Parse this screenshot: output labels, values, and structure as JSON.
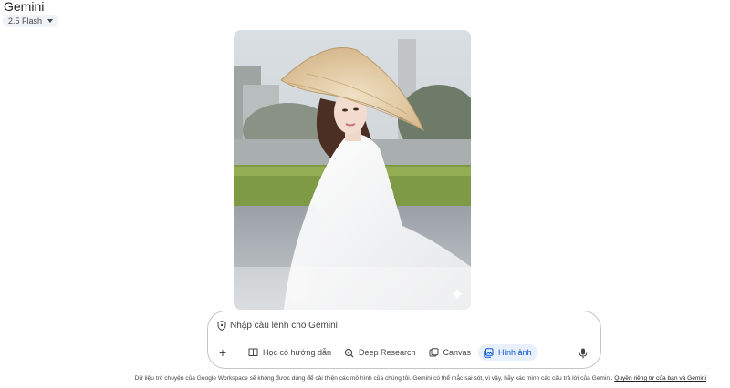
{
  "header": {
    "app_title": "Gemini",
    "model_label": "2.5 Flash"
  },
  "composer": {
    "placeholder": "Nhập câu lệnh cho Gemini",
    "tools": [
      {
        "label": "Học có hướng dẫn",
        "icon": "guided-learning-icon"
      },
      {
        "label": "Deep Research",
        "icon": "deep-research-icon"
      },
      {
        "label": "Canvas",
        "icon": "canvas-icon"
      },
      {
        "label": "Hình ảnh",
        "icon": "image-icon",
        "active": true
      }
    ]
  },
  "footer": {
    "disclaimer": "Dữ liệu trò chuyện của Google Workspace sẽ không được dùng để cải thiện các mô hình của chúng tôi. Gemini có thể mắc sai sót, vì vậy, hãy xác minh các câu trả lời của Gemini.",
    "privacy_link": "Quyền riêng tư của bạn và Gemini"
  },
  "colors": {
    "accent": "#0b57d0",
    "active_chip_bg": "#e8f0fe",
    "border": "#c4c7c5",
    "text_muted": "#444746"
  }
}
